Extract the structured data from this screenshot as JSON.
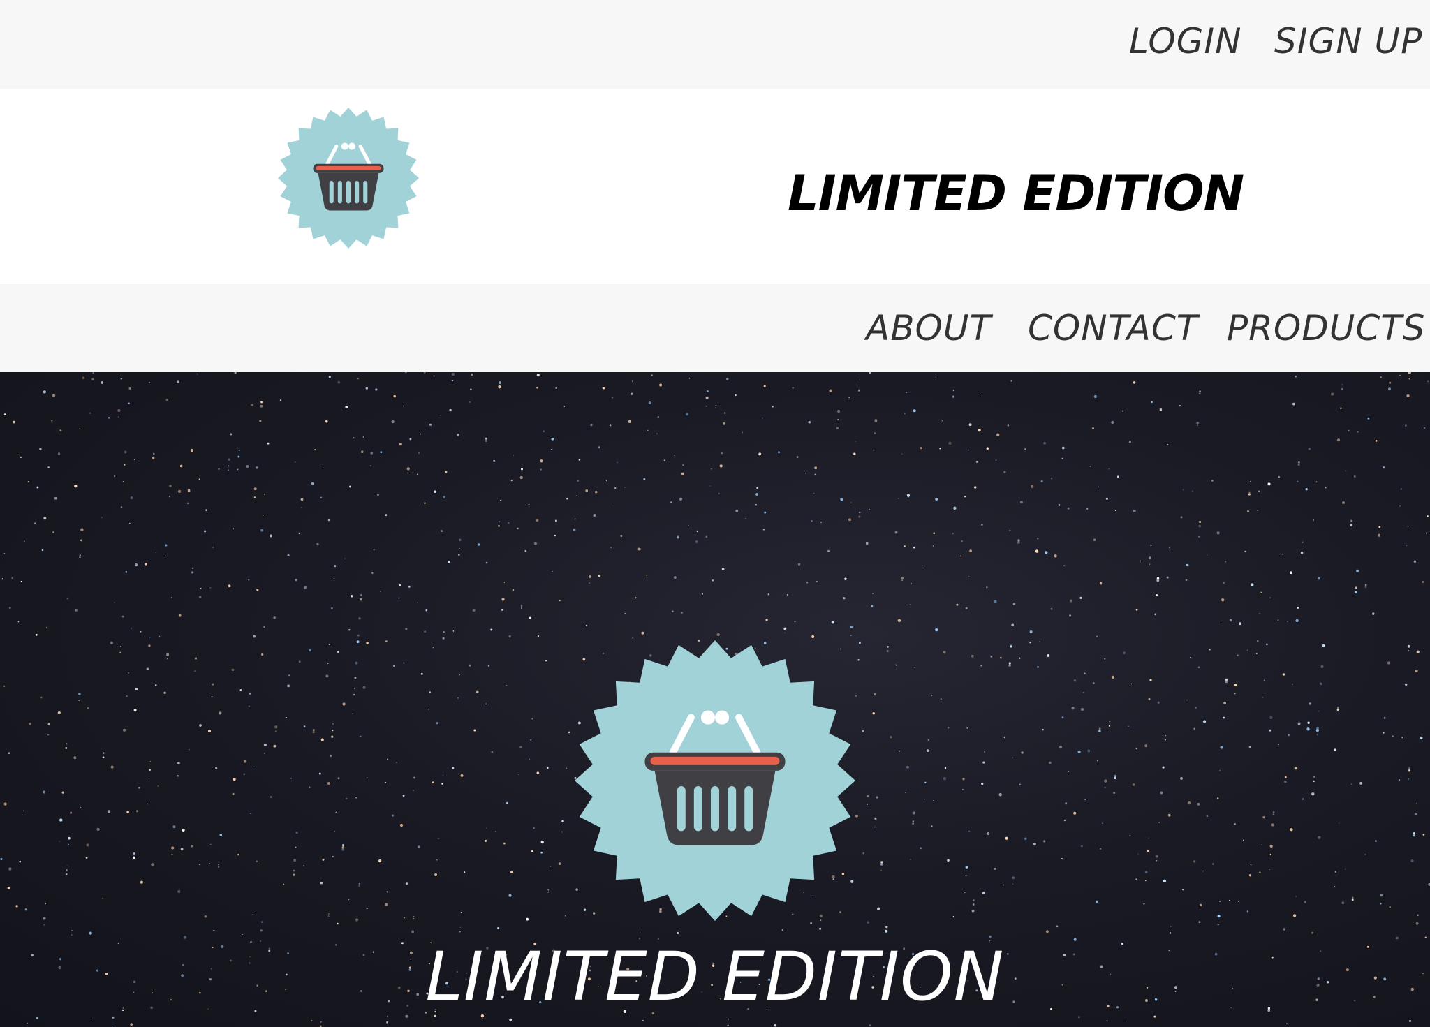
{
  "topbar": {
    "login_label": "LOGIN",
    "signup_label": "SIGN UP"
  },
  "header": {
    "brand": "LIMITED EDITION",
    "logo_icon": "basket-badge-icon"
  },
  "nav": {
    "items": [
      {
        "label": "ABOUT"
      },
      {
        "label": "CONTACT"
      },
      {
        "label": "PRODUCTS"
      }
    ]
  },
  "hero": {
    "title": "LIMITED EDITION",
    "logo_icon": "basket-badge-icon",
    "background": "starry-night-sky"
  },
  "colors": {
    "badge": "#a0d2d8",
    "basket": "#404044",
    "basket_rim": "#e8604c",
    "handle": "#ffffff",
    "bar_bg": "#f7f7f7",
    "hero_bg": "#1a1a24"
  }
}
